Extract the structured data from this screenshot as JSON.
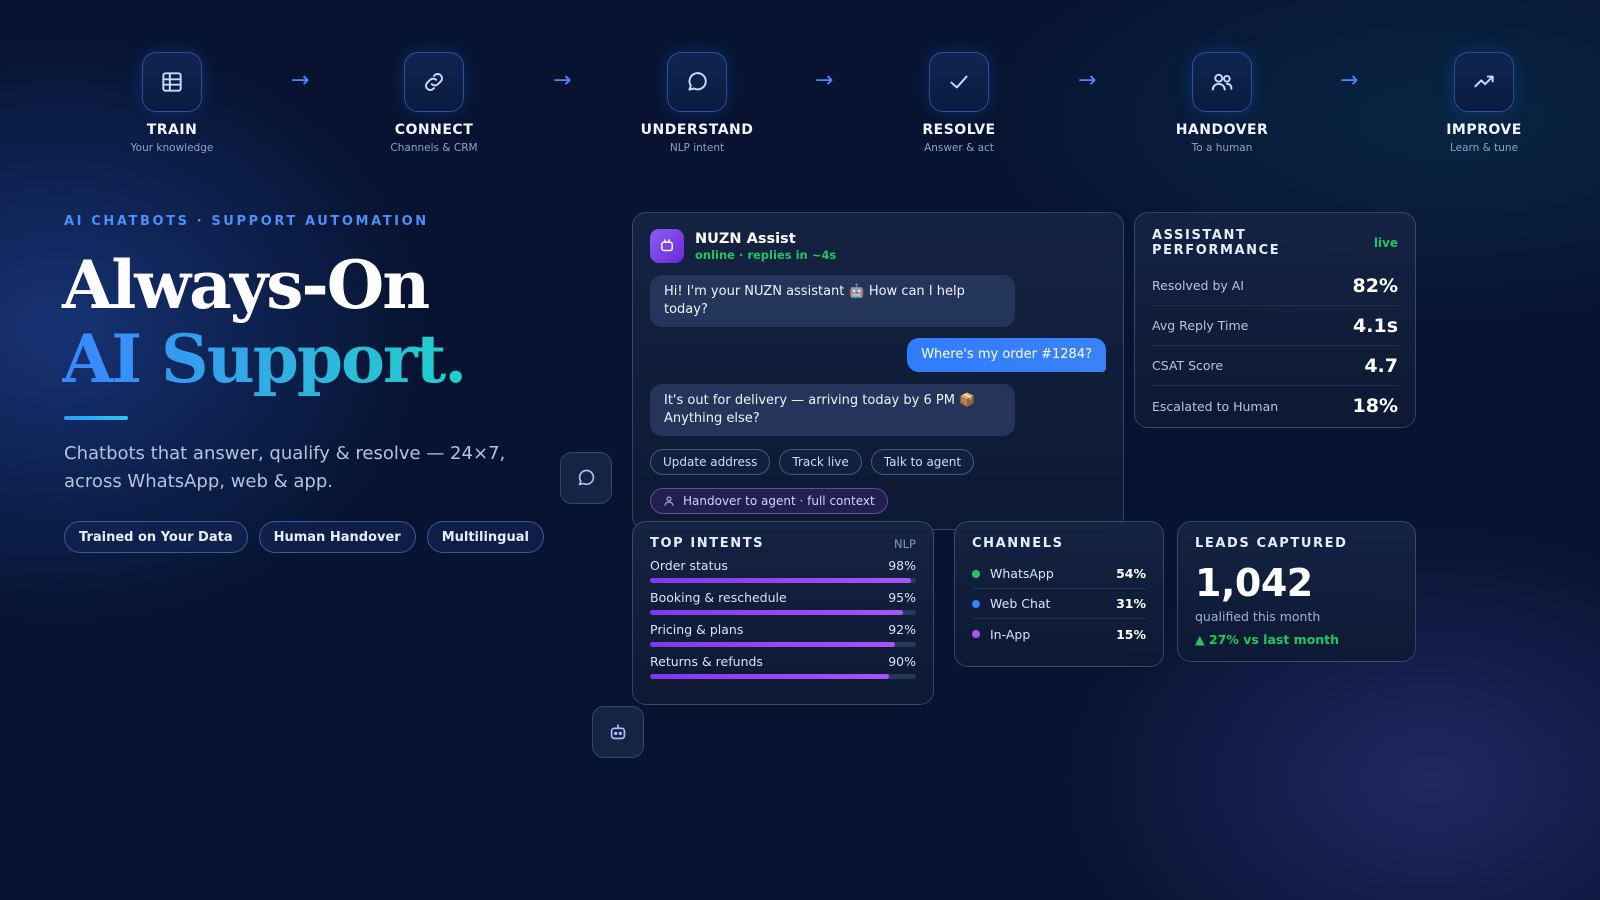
{
  "steps": [
    {
      "title": "TRAIN",
      "sub": "Your knowledge",
      "icon": "table-icon"
    },
    {
      "title": "CONNECT",
      "sub": "Channels & CRM",
      "icon": "link-icon"
    },
    {
      "title": "UNDERSTAND",
      "sub": "NLP intent",
      "icon": "chat-bubble-icon"
    },
    {
      "title": "RESOLVE",
      "sub": "Answer & act",
      "icon": "check-icon"
    },
    {
      "title": "HANDOVER",
      "sub": "To a human",
      "icon": "users-icon"
    },
    {
      "title": "IMPROVE",
      "sub": "Learn & tune",
      "icon": "trend-up-icon"
    }
  ],
  "arrow_glyph": "→",
  "hero": {
    "eyebrow": "AI CHATBOTS · SUPPORT AUTOMATION",
    "title_line1": "Always-On",
    "title_line2": "AI Support.",
    "lede": "Chatbots that answer, qualify & resolve — 24×7, across WhatsApp, web & app.",
    "pills": [
      "Trained on Your Data",
      "Human Handover",
      "Multilingual"
    ]
  },
  "chat": {
    "name": "NUZN Assist",
    "status": "online · replies in ~4s",
    "messages": [
      {
        "from": "bot",
        "text": "Hi! I'm your NUZN assistant 🤖 How can I help today?"
      },
      {
        "from": "user",
        "text": "Where's my order #1284?"
      },
      {
        "from": "bot",
        "text": "It's out for delivery — arriving today by 6 PM 📦 Anything else?"
      }
    ],
    "quick_replies": [
      "Update address",
      "Track live",
      "Talk to agent"
    ],
    "handover": "Handover to agent · full context"
  },
  "performance": {
    "title": "ASSISTANT PERFORMANCE",
    "badge": "live",
    "rows": [
      {
        "label": "Resolved by AI",
        "value": "82%"
      },
      {
        "label": "Avg Reply Time",
        "value": "4.1s"
      },
      {
        "label": "CSAT Score",
        "value": "4.7"
      },
      {
        "label": "Escalated to Human",
        "value": "18%"
      }
    ]
  },
  "intents": {
    "title": "TOP INTENTS",
    "tag": "NLP",
    "rows": [
      {
        "label": "Order status",
        "value": "98%",
        "fill": 0.98
      },
      {
        "label": "Booking & reschedule",
        "value": "95%",
        "fill": 0.95
      },
      {
        "label": "Pricing & plans",
        "value": "92%",
        "fill": 0.92
      },
      {
        "label": "Returns & refunds",
        "value": "90%",
        "fill": 0.9
      }
    ]
  },
  "channels": {
    "title": "CHANNELS",
    "rows": [
      {
        "label": "WhatsApp",
        "value": "54%",
        "color": "#22c55e"
      },
      {
        "label": "Web Chat",
        "value": "31%",
        "color": "#3b82f6"
      },
      {
        "label": "In-App",
        "value": "15%",
        "color": "#a855f7"
      }
    ]
  },
  "leads": {
    "title": "LEADS CAPTURED",
    "value": "1,042",
    "sub": "qualified this month",
    "trend": "▲ 27% vs last month"
  }
}
